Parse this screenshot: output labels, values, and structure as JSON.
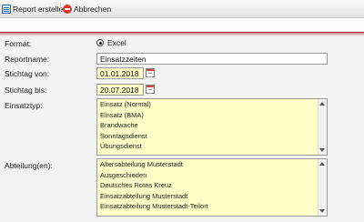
{
  "toolbar": {
    "report_label": "Report erstellen",
    "cancel_label": "Abbrechen"
  },
  "form": {
    "format_label": "Format:",
    "format_value": "Excel",
    "reportname_label": "Reportname:",
    "reportname_value": "Einsatzzeiten",
    "stichtag_von_label": "Stichtag von:",
    "stichtag_von_value": "01.01.2018",
    "stichtag_bis_label": "Stichtag bis:",
    "stichtag_bis_value": "20.07.2018",
    "einsatztyp_label": "Einsatztyp:",
    "einsatztyp_options": [
      "Einsatz (Normal)",
      "Einsatz (BMA)",
      "Brandwache",
      "Sonntagsdienst",
      "Übungsdienst"
    ],
    "abteilung_label": "Abteilung(en):",
    "abteilung_options": [
      "Altersabteilung Musterstadt",
      "Ausgeschieden",
      "Deutsches Rotes Kreuz",
      "Einsatzabteilung Musterstadt",
      "Einsatzabteilung Musterstadt-Teilort"
    ]
  },
  "icons": {
    "report": "report-icon",
    "cancel": "cancel-icon",
    "calendar": "calendar-icon"
  },
  "colors": {
    "field_yellow": "#ffffc8",
    "accent_red": "#a52a2a",
    "cancel_red": "#d9362b"
  }
}
